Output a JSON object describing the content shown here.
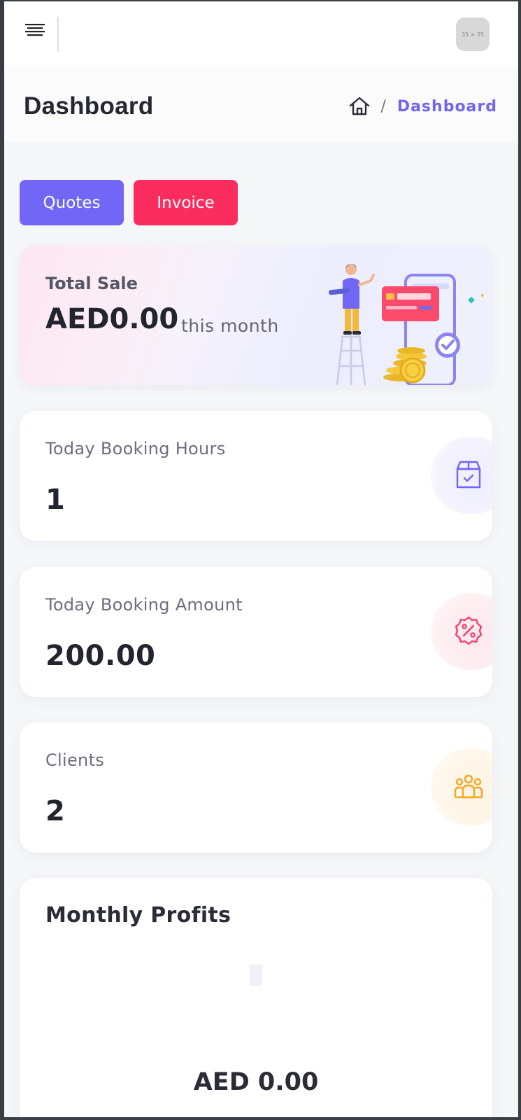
{
  "topbar": {
    "menu_icon": "hamburger-menu-icon",
    "avatar_placeholder": "35 × 35"
  },
  "header": {
    "title": "Dashboard",
    "breadcrumb": {
      "home_icon": "home-icon",
      "separator": "/",
      "current": "Dashboard"
    }
  },
  "actions": {
    "quotes_label": "Quotes",
    "invoice_label": "Invoice"
  },
  "total_sale": {
    "label": "Total Sale",
    "value": "AED0.00",
    "suffix": "this month",
    "illustration": "payment-illustration"
  },
  "stats": [
    {
      "label": "Today Booking Hours",
      "value": "1",
      "icon": "shopping-bag-check-icon",
      "color": "#7166f5"
    },
    {
      "label": "Today Booking Amount",
      "value": "200.00",
      "icon": "discount-badge-icon",
      "color": "#f23d6e"
    },
    {
      "label": "Clients",
      "value": "2",
      "icon": "users-group-icon",
      "color": "#f5a623"
    }
  ],
  "monthly_profits": {
    "title": "Monthly Profits",
    "value": "AED 0.00"
  },
  "colors": {
    "primary": "#7166f5",
    "danger": "#fb2d5f",
    "warning": "#f5a623"
  }
}
